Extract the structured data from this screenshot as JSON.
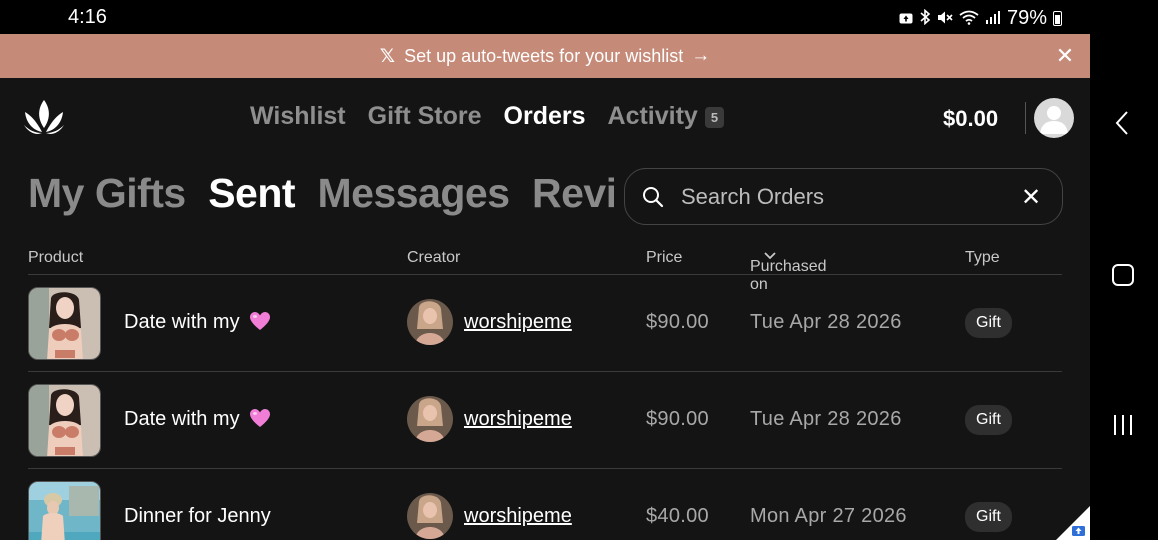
{
  "status_bar": {
    "time": "4:16",
    "battery_percent": "79%"
  },
  "banner": {
    "text": "Set up auto-tweets for your wishlist",
    "arrow": "→",
    "close": "✕",
    "icon": "x-logo-icon"
  },
  "nav": {
    "links": [
      {
        "label": "Wishlist",
        "active": false
      },
      {
        "label": "Gift Store",
        "active": false
      },
      {
        "label": "Orders",
        "active": true
      },
      {
        "label": "Activity",
        "active": false
      }
    ],
    "activity_badge": "5",
    "balance": "$0.00"
  },
  "subtabs": [
    {
      "label": "My Gifts",
      "active": false
    },
    {
      "label": "Sent",
      "active": true
    },
    {
      "label": "Messages",
      "active": false
    },
    {
      "label": "Reviews",
      "active": false
    }
  ],
  "search": {
    "placeholder": "Search Orders",
    "value": "",
    "clear": "✕"
  },
  "table": {
    "columns": {
      "product": "Product",
      "creator": "Creator",
      "price": "Price",
      "purchased_on": "Purchased on",
      "type": "Type"
    },
    "rows": [
      {
        "product": "Date with my",
        "emoji": "pink-heart-icon",
        "creator": "worshipeme",
        "price": "$90.00",
        "date": "Tue Apr 28 2026",
        "type": "Gift"
      },
      {
        "product": "Date with my",
        "emoji": "pink-heart-icon",
        "creator": "worshipeme",
        "price": "$90.00",
        "date": "Tue Apr 28 2026",
        "type": "Gift"
      },
      {
        "product": "Dinner for Jenny",
        "emoji": "",
        "creator": "worshipeme",
        "price": "$40.00",
        "date": "Mon Apr 27 2026",
        "type": "Gift"
      }
    ]
  },
  "colors": {
    "banner_bg": "#c68a78",
    "app_bg": "#141414",
    "heart": "#f080d8"
  }
}
